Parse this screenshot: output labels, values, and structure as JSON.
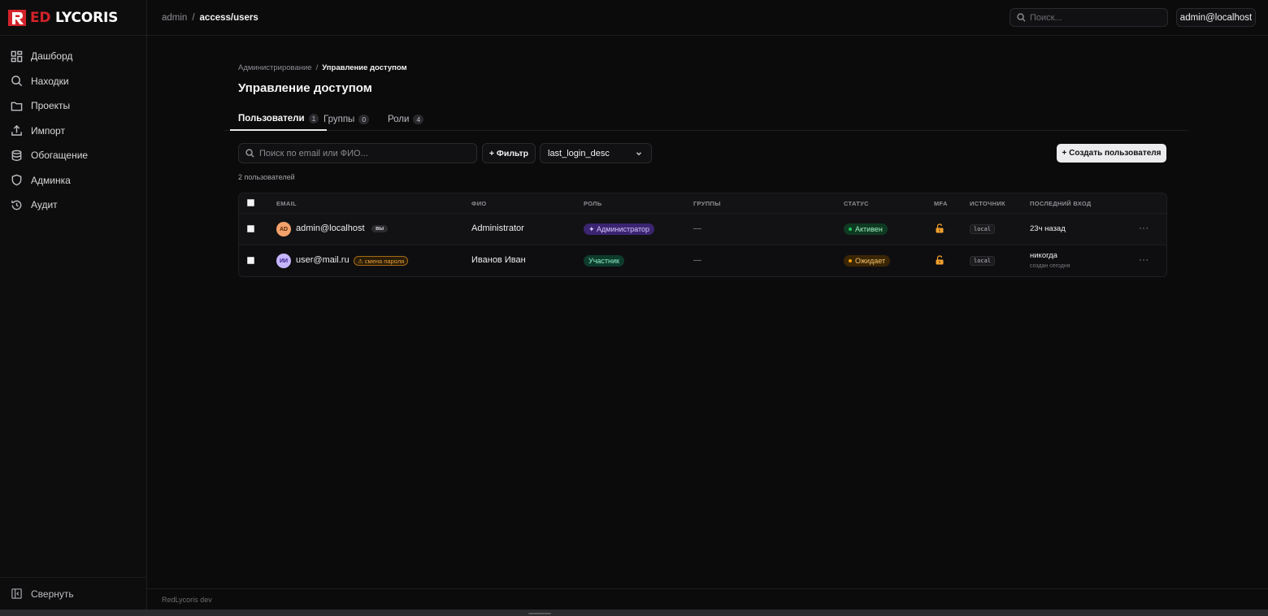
{
  "brand": {
    "name_red": "R",
    "name_white": "ED ",
    "name_rest": "LYCORIS",
    "accent": "#d3222a"
  },
  "sidebar": {
    "items": [
      {
        "label": "Дашборд",
        "icon": "dashboard-icon"
      },
      {
        "label": "Находки",
        "icon": "search-icon"
      },
      {
        "label": "Проекты",
        "icon": "folder-icon"
      },
      {
        "label": "Импорт",
        "icon": "upload-icon"
      },
      {
        "label": "Обогащение",
        "icon": "database-icon"
      },
      {
        "label": "Админка",
        "icon": "shield-icon"
      },
      {
        "label": "Аудит",
        "icon": "history-icon"
      }
    ],
    "collapse_label": "Свернуть"
  },
  "topbar": {
    "crumb_root": "admin",
    "crumb_sep": "/",
    "crumb_current": "access/users",
    "search_placeholder": "Поиск...",
    "user": "admin@localhost"
  },
  "page": {
    "crumb_root": "Администрирование",
    "crumb_sep": "/",
    "crumb_current": "Управление доступом",
    "title": "Управление доступом",
    "tabs": [
      {
        "label": "Пользователи",
        "count": "1"
      },
      {
        "label": "Группы",
        "count": "0"
      },
      {
        "label": "Роли",
        "count": "4"
      }
    ],
    "search_placeholder": "Поиск по email или ФИО...",
    "filter_label": "+ Фильтр",
    "sort_value": "last_login_desc",
    "create_label": "+ Создать пользователя",
    "user_count": "2 пользователей"
  },
  "table": {
    "headers": {
      "email": "EMAIL",
      "fio": "ФИО",
      "role": "РОЛЬ",
      "groups": "ГРУППЫ",
      "status": "СТАТУС",
      "mfa": "MFA",
      "source": "ИСТОЧНИК",
      "last_login": "ПОСЛЕДНИЙ ВХОД"
    },
    "rows": [
      {
        "initials": "AD",
        "email": "admin@localhost",
        "you_badge": "вы",
        "fio": "Administrator",
        "role": "✦ Администратор",
        "groups": "—",
        "status": "Активен",
        "source": "local",
        "last_login": "23ч назад",
        "more": "···"
      },
      {
        "initials": "ИИ",
        "email": "user@mail.ru",
        "warning": "⚠ смена пароля",
        "fio": "Иванов Иван",
        "role": "Участник",
        "groups": "—",
        "status": "Ожидает",
        "source": "local",
        "last_login": "никогда",
        "last_login_sub": "создан сегодня",
        "more": "···"
      }
    ]
  },
  "footer": {
    "text": "RedLycoris dev"
  },
  "colors": {
    "active_green": "#22c55e",
    "pending_amber": "#f59e0b",
    "admin_purple": "#8b5cf6",
    "member_green": "#10b981"
  }
}
